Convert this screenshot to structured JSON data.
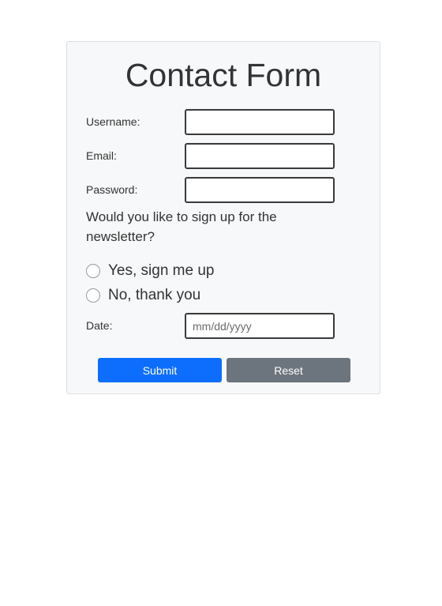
{
  "form": {
    "title": "Contact Form",
    "username_label": "Username:",
    "email_label": "Email:",
    "password_label": "Password:",
    "newsletter_question": "Would you like to sign up for the newsletter?",
    "radio_yes_label": "Yes, sign me up",
    "radio_no_label": "No, thank you",
    "date_label": "Date:",
    "date_placeholder": "mm/dd/yyyy",
    "submit_label": "Submit",
    "reset_label": "Reset"
  },
  "colors": {
    "submit_button": "#0d6efd",
    "reset_button": "#6c757d",
    "card_background": "#f7f8f9"
  }
}
